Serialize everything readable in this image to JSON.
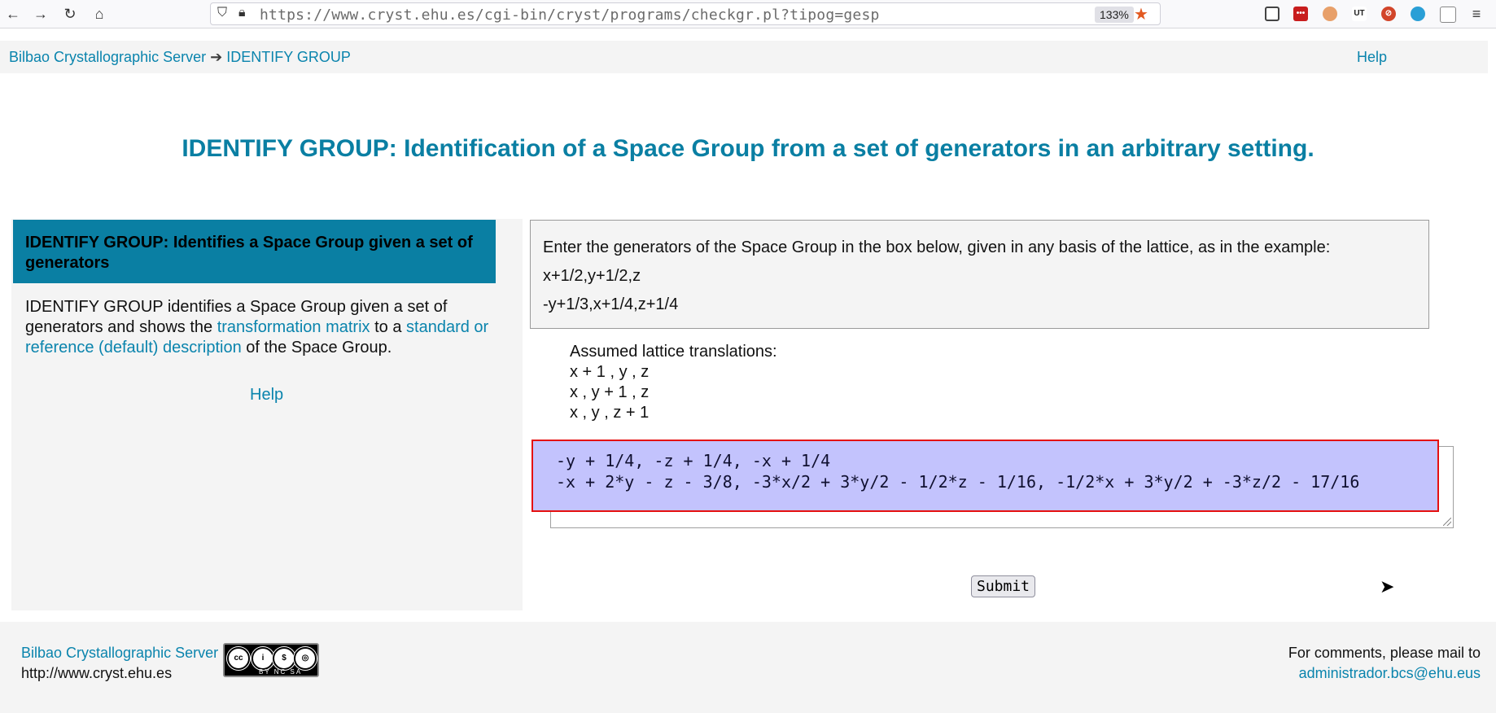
{
  "browser": {
    "url": "https://www.cryst.ehu.es/cgi-bin/cryst/programs/checkgr.pl?tipog=gesp",
    "zoom": "133%"
  },
  "header": {
    "breadcrumb_home": "Bilbao Crystallographic Server",
    "breadcrumb_arrow": "➔",
    "breadcrumb_current": "IDENTIFY GROUP",
    "help": "Help"
  },
  "page_title": "IDENTIFY GROUP: Identification of a Space Group from a set of generators in an arbitrary setting.",
  "left_panel": {
    "heading": "IDENTIFY GROUP: Identifies a Space Group given a set of generators",
    "desc_part1": "IDENTIFY GROUP identifies a Space Group given a set of generators and shows the ",
    "desc_link1": "transformation matrix",
    "desc_part2": " to a ",
    "desc_link2": "standard or reference (default) description",
    "desc_part3": " of the Space Group.",
    "help": "Help"
  },
  "instructions": {
    "text": "Enter the generators of the Space Group in the box below, given in any basis of the lattice, as in the example:",
    "example_line1": "x+1/2,y+1/2,z",
    "example_line2": "-y+1/3,x+1/4,z+1/4"
  },
  "lattice": {
    "title": "Assumed lattice translations:",
    "t1": "x + 1 , y , z",
    "t2": "x , y + 1 , z",
    "t3": "x , y , z + 1"
  },
  "generators_input": {
    "value": "-y + 1/4, -z + 1/4, -x + 1/4\n-x + 2*y - z - 3/8, -3*x/2 + 3*y/2 - 1/2*z - 1/16, -1/2*x + 3*y/2 + -3*z/2 - 17/16"
  },
  "submit_label": "Submit",
  "footer": {
    "server_link": "Bilbao Crystallographic Server",
    "server_url": "http://www.cryst.ehu.es",
    "comments": "For comments, please mail to",
    "email": "administrador.bcs@ehu.eus",
    "cc_text": "BY NC SA"
  }
}
